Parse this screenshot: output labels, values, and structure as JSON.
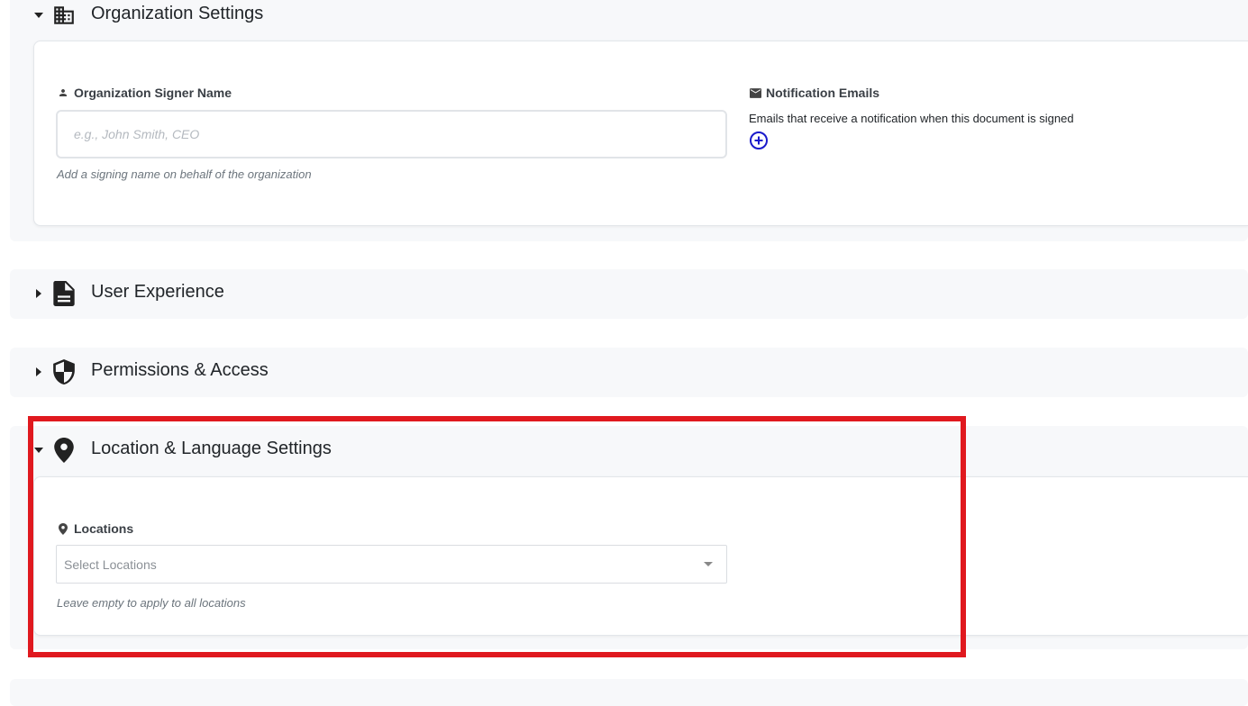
{
  "organization_settings": {
    "title": "Organization Settings",
    "expanded": true,
    "signer_name": {
      "label": "Organization Signer Name",
      "placeholder": "e.g., John Smith, CEO",
      "value": "",
      "hint": "Add a signing name on behalf of the organization"
    },
    "notification_emails": {
      "label": "Notification Emails",
      "description": "Emails that receive a notification when this document is signed"
    }
  },
  "user_experience": {
    "title": "User Experience",
    "expanded": false
  },
  "permissions_access": {
    "title": "Permissions & Access",
    "expanded": false
  },
  "location_language": {
    "title": "Location & Language Settings",
    "expanded": true,
    "locations": {
      "label": "Locations",
      "placeholder": "Select Locations",
      "hint": "Leave empty to apply to all locations"
    }
  },
  "colors": {
    "highlight": "#e0191f",
    "add_icon": "#1a1acb",
    "section_bg": "#f7f8fa"
  },
  "icons": {
    "organization": "building-icon",
    "user_experience": "document-icon",
    "permissions": "shield-icon",
    "location": "map-pin-icon",
    "person": "person-icon",
    "email": "envelope-icon",
    "add": "plus-circle-icon"
  }
}
